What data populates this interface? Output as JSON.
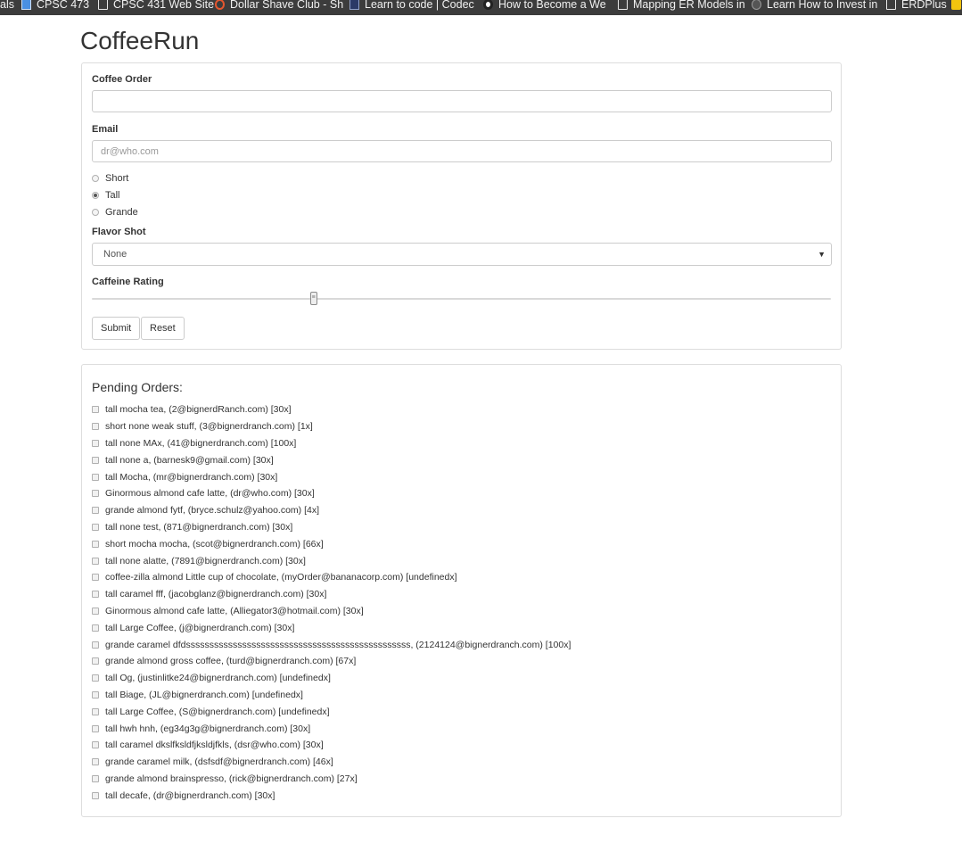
{
  "bookmarks": [
    {
      "label": "als",
      "icon": "none"
    },
    {
      "label": "CPSC 473",
      "icon": "bookmark-icon"
    },
    {
      "label": "CPSC 431 Web Site",
      "icon": "page-icon"
    },
    {
      "label": "Dollar Shave Club - Sh",
      "icon": "circle-icon"
    },
    {
      "label": "Learn to code | Codec",
      "icon": "codecademy-icon"
    },
    {
      "label": "How to Become a We",
      "icon": "panda-icon"
    },
    {
      "label": "Mapping ER Models in",
      "icon": "page-icon"
    },
    {
      "label": "Learn How to Invest in",
      "icon": "dark-icon"
    },
    {
      "label": "ERDPlus",
      "icon": "page-icon"
    }
  ],
  "app": {
    "title": "CoffeeRun"
  },
  "form": {
    "coffee_label": "Coffee Order",
    "coffee_value": "",
    "email_label": "Email",
    "email_placeholder": "dr@who.com",
    "sizes": [
      {
        "label": "Short",
        "checked": false
      },
      {
        "label": "Tall",
        "checked": true
      },
      {
        "label": "Grande",
        "checked": false
      }
    ],
    "flavor_label": "Flavor Shot",
    "flavor_selected": "None",
    "caffeine_label": "Caffeine Rating",
    "caffeine_value": 30,
    "caffeine_min": 0,
    "caffeine_max": 100,
    "submit_label": "Submit",
    "reset_label": "Reset"
  },
  "orders": {
    "title": "Pending Orders:",
    "items": [
      "tall mocha tea, (2@bignerdRanch.com) [30x]",
      "short none weak stuff, (3@bignerdranch.com) [1x]",
      "tall none MAx, (41@bignerdranch.com) [100x]",
      "tall none a, (barnesk9@gmail.com) [30x]",
      "tall Mocha, (mr@bignerdranch.com) [30x]",
      "Ginormous almond cafe latte, (dr@who.com) [30x]",
      "grande almond fytf, (bryce.schulz@yahoo.com) [4x]",
      "tall none test, (871@bignerdranch.com) [30x]",
      "short mocha mocha, (scot@bignerdranch.com) [66x]",
      "tall none alatte, (7891@bignerdranch.com) [30x]",
      "coffee-zilla almond Little cup of chocolate, (myOrder@bananacorp.com) [undefinedx]",
      "tall caramel fff, (jacobglanz@bignerdranch.com) [30x]",
      "Ginormous almond cafe latte, (Alliegator3@hotmail.com) [30x]",
      "tall Large Coffee, (j@bignerdranch.com) [30x]",
      "grande caramel dfdssssssssssssssssssssssssssssssssssssssssssssssss, (2124124@bignerdranch.com) [100x]",
      "grande almond gross coffee, (turd@bignerdranch.com) [67x]",
      "tall Og, (justinlitke24@bignerdranch.com) [undefinedx]",
      "tall Biage, (JL@bignerdranch.com) [undefinedx]",
      "tall Large Coffee, (S@bignerdranch.com) [undefinedx]",
      "tall hwh hnh, (eg34g3g@bignerdranch.com) [30x]",
      "tall caramel dkslfksldfjksldjfkls, (dsr@who.com) [30x]",
      "grande caramel milk, (dsfsdf@bignerdranch.com) [46x]",
      "grande almond brainspresso, (rick@bignerdranch.com) [27x]",
      "tall decafe, (dr@bignerdranch.com) [30x]"
    ]
  }
}
